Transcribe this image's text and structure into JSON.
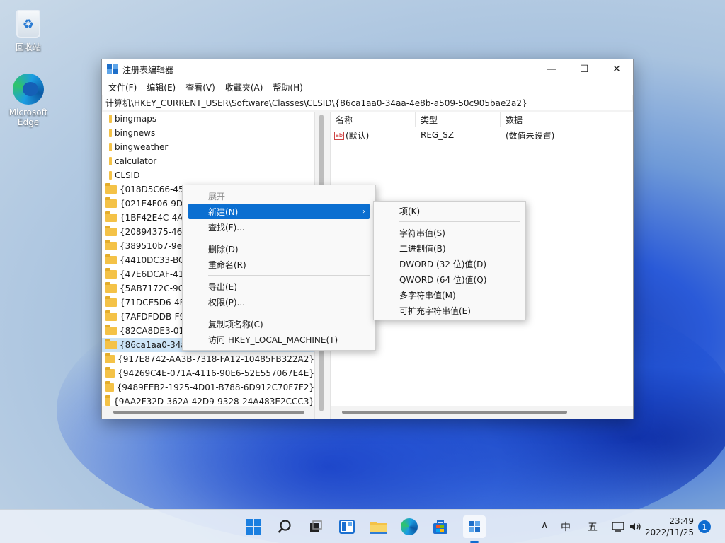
{
  "desktop": {
    "icons": [
      {
        "label": "回收站"
      },
      {
        "label": "Microsoft Edge"
      }
    ]
  },
  "window": {
    "title": "注册表编辑器",
    "controls": {
      "minimize": "—",
      "maximize": "☐",
      "close": "✕"
    },
    "menu": [
      "文件(F)",
      "编辑(E)",
      "查看(V)",
      "收藏夹(A)",
      "帮助(H)"
    ],
    "address": "计算机\\HKEY_CURRENT_USER\\Software\\Classes\\CLSID\\{86ca1aa0-34aa-4e8b-a509-50c905bae2a2}"
  },
  "tree": {
    "top_items": [
      "bingmaps",
      "bingnews",
      "bingweather",
      "calculator",
      "CLSID"
    ],
    "clsid_items": [
      "{018D5C66-453",
      "{021E4F06-9DC",
      "{1BF42E4C-4AF",
      "{20894375-46A",
      "{389510b7-9e5",
      "{4410DC33-BC7",
      "{47E6DCAF-41F",
      "{5AB7172C-9C1",
      "{71DCE5D6-4B",
      "{7AFDFDDB-F9",
      "{82CA8DE3-01A",
      "{86ca1aa0-34a",
      "{917E8742-AA3B-7318-FA12-10485FB322A2}",
      "{94269C4E-071A-4116-90E6-52E557067E4E}",
      "{9489FEB2-1925-4D01-B788-6D912C70F7F2}",
      "{9AA2F32D-362A-42D9-9328-24A483E2CCC3}"
    ],
    "selected_index": 11
  },
  "values": {
    "headers": [
      "名称",
      "类型",
      "数据"
    ],
    "rows": [
      {
        "name": "(默认)",
        "type": "REG_SZ",
        "data": "(数值未设置)",
        "icon": "ab"
      }
    ]
  },
  "context_menu": {
    "items": [
      {
        "label": "展开",
        "disabled": true
      },
      {
        "label": "新建(N)",
        "highlight": true,
        "arrow": "›"
      },
      {
        "label": "查找(F)..."
      },
      {
        "sep": true
      },
      {
        "label": "删除(D)"
      },
      {
        "label": "重命名(R)"
      },
      {
        "sep": true
      },
      {
        "label": "导出(E)"
      },
      {
        "label": "权限(P)..."
      },
      {
        "sep": true
      },
      {
        "label": "复制项名称(C)"
      },
      {
        "label": "访问 HKEY_LOCAL_MACHINE(T)"
      }
    ]
  },
  "submenu": {
    "items": [
      {
        "label": "项(K)"
      },
      {
        "sep": true
      },
      {
        "label": "字符串值(S)"
      },
      {
        "label": "二进制值(B)"
      },
      {
        "label": "DWORD (32 位)值(D)"
      },
      {
        "label": "QWORD (64 位)值(Q)"
      },
      {
        "label": "多字符串值(M)"
      },
      {
        "label": "可扩充字符串值(E)"
      }
    ]
  },
  "taskbar": {
    "tray": {
      "chevron": "∧",
      "ime_lang": "中",
      "ime_mode": "五"
    },
    "time": "23:49",
    "date": "2022/11/25",
    "notification_count": "1"
  },
  "colors": {
    "highlight": "#0b6fd1",
    "selection": "#cce4f7",
    "folder": "#f4c247"
  }
}
